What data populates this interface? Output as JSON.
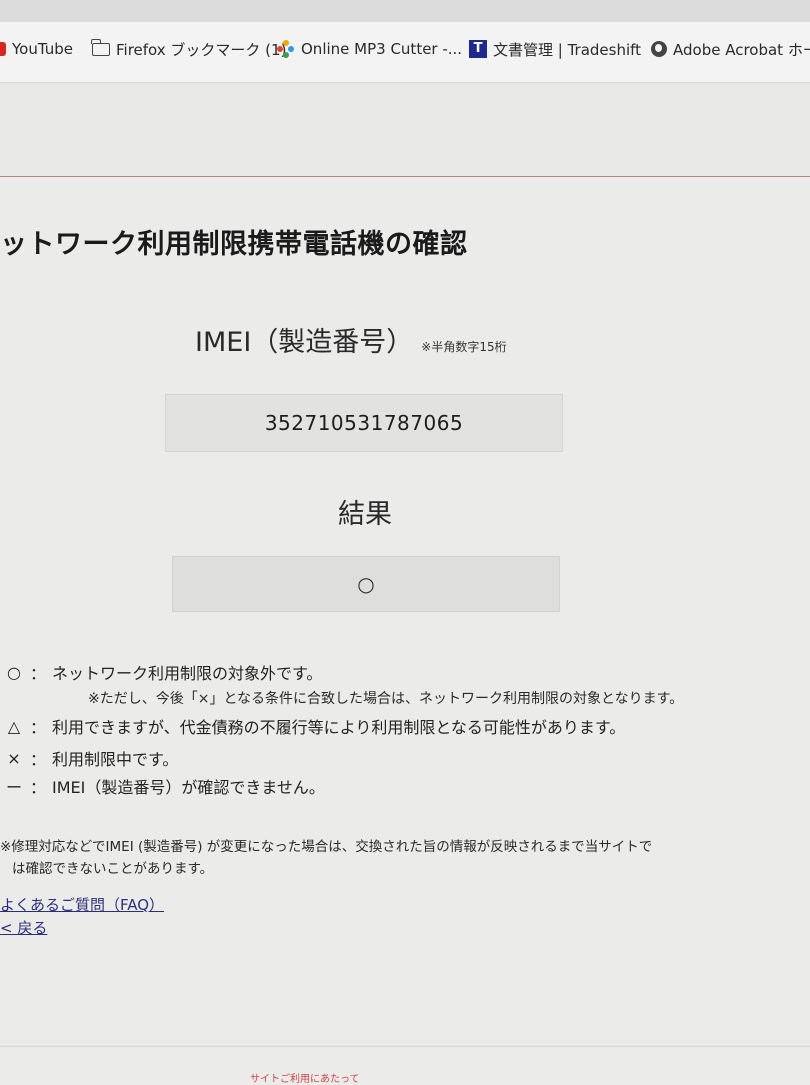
{
  "bookmarks": [
    {
      "label": "YouTube",
      "icon": "youtube-icon"
    },
    {
      "label": "Firefox ブックマーク (1)",
      "icon": "folder-icon"
    },
    {
      "label": "Online MP3 Cutter -...",
      "icon": "mp3-cutter-icon"
    },
    {
      "label": "文書管理 | Tradeshift",
      "icon": "tradeshift-icon"
    },
    {
      "label": "Adobe Acrobat ホーム",
      "icon": "globe-icon"
    }
  ],
  "page": {
    "title": "ットワーク利用制限携帯電話機の確認"
  },
  "form": {
    "imei_label": "IMEI（製造番号）",
    "imei_note": "※半角数字15桁",
    "imei_value": "352710531787065",
    "result_label": "結果",
    "result_value": "○"
  },
  "legend": {
    "items": [
      {
        "symbol": "○",
        "sep": "：",
        "text": "ネットワーク利用制限の対象外です。"
      },
      {
        "symbol": "△",
        "sep": "：",
        "text": "利用できますが、代金債務の不履行等により利用制限となる可能性があります。"
      },
      {
        "symbol": "×",
        "sep": "：",
        "text": "利用制限中です。"
      },
      {
        "symbol": "ー",
        "sep": "：",
        "text": "IMEI（製造番号）が確認できません。"
      }
    ],
    "sub_note": "※ただし、今後「×」となる条件に合致した場合は、ネットワーク利用制限の対象となります。"
  },
  "notice": {
    "line1": "※修理対応などでIMEI (製造番号) が変更になった場合は、交換された旨の情報が反映されるまで当サイトで",
    "line2": "は確認できないことがあります。"
  },
  "links": {
    "faq": "よくあるご質問（FAQ）",
    "back": "< 戻る"
  },
  "footer": {
    "partial": "サイトご利用にあたって"
  },
  "colors": {
    "youtube": "#d7261e",
    "tradeshift": "#1d2a8c",
    "link": "#2b2f7a",
    "divider": "#b9868a"
  }
}
